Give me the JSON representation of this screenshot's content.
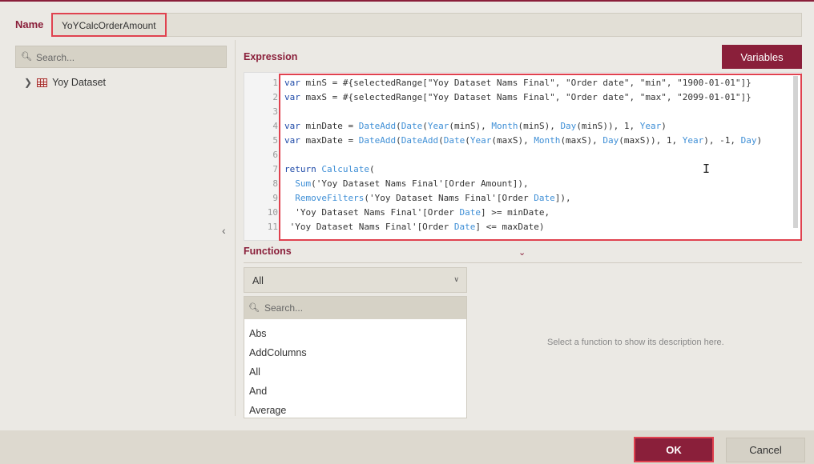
{
  "name": {
    "label": "Name",
    "value": "YoYCalcOrderAmount"
  },
  "data_source_panel": {
    "search_placeholder": "Search...",
    "tree": [
      {
        "label": "Yoy Dataset",
        "icon": "table-icon",
        "expanded": false
      }
    ]
  },
  "expression": {
    "label": "Expression",
    "variables_button": "Variables",
    "lines": [
      {
        "n": "1",
        "text": "var minS = #{selectedRange[\"Yoy Dataset Nams Final\", \"Order date\", \"min\", \"1900-01-01\"]}"
      },
      {
        "n": "2",
        "text": "var maxS = #{selectedRange[\"Yoy Dataset Nams Final\", \"Order date\", \"max\", \"2099-01-01\"]}"
      },
      {
        "n": "3",
        "text": ""
      },
      {
        "n": "4",
        "text": "var minDate = DateAdd(Date(Year(minS), Month(minS), Day(minS)), 1, Year)"
      },
      {
        "n": "5",
        "text": "var maxDate = DateAdd(DateAdd(Date(Year(maxS), Month(maxS), Day(maxS)), 1, Year), -1, Day)"
      },
      {
        "n": "6",
        "text": ""
      },
      {
        "n": "7",
        "text": "return Calculate("
      },
      {
        "n": "8",
        "text": "  Sum('Yoy Dataset Nams Final'[Order Amount]),"
      },
      {
        "n": "9",
        "text": "  RemoveFilters('Yoy Dataset Nams Final'[Order Date]),"
      },
      {
        "n": "10",
        "text": "  'Yoy Dataset Nams Final'[Order Date] >= minDate,"
      },
      {
        "n": "11",
        "text": " 'Yoy Dataset Nams Final'[Order Date] <= maxDate)"
      }
    ]
  },
  "functions": {
    "label": "Functions",
    "category_selected": "All",
    "search_placeholder": "Search...",
    "items": [
      "Abs",
      "AddColumns",
      "All",
      "And",
      "Average"
    ],
    "description_placeholder": "Select a function to show its description here."
  },
  "footer": {
    "ok": "OK",
    "cancel": "Cancel"
  },
  "colors": {
    "accent": "#8a1f3a",
    "highlight_border": "#e0424f",
    "background": "#ebe9e4"
  }
}
